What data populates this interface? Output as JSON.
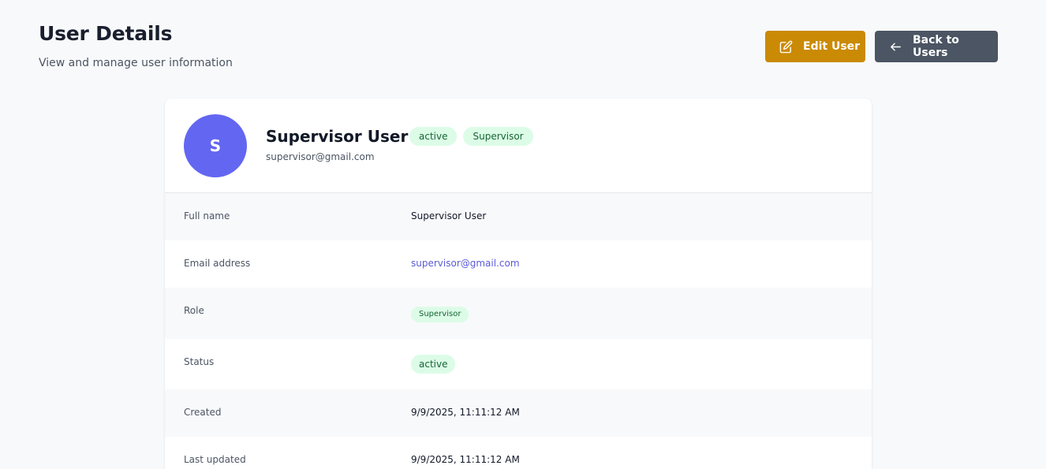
{
  "header": {
    "title": "User Details",
    "subtitle": "View and manage user information",
    "edit_label": "Edit User",
    "back_label": "Back to Users"
  },
  "icons": {
    "edit": "edit-icon",
    "back": "arrow-left-icon"
  },
  "colors": {
    "edit_button": "#ca8a04",
    "back_button": "#4b5563",
    "avatar": "#6366f1",
    "badge_bg": "#dcfce7",
    "badge_text": "#166534",
    "link": "#5b5bd6"
  },
  "profile": {
    "initial": "S",
    "name": "Supervisor User",
    "email": "supervisor@gmail.com",
    "status_badge": "active",
    "role_badge": "Supervisor"
  },
  "details": {
    "full_name": {
      "label": "Full name",
      "value": "Supervisor User"
    },
    "email": {
      "label": "Email address",
      "value": "supervisor@gmail.com"
    },
    "role": {
      "label": "Role",
      "value": "Supervisor"
    },
    "status": {
      "label": "Status",
      "value": "active"
    },
    "created": {
      "label": "Created",
      "value": "9/9/2025, 11:11:12 AM"
    },
    "updated": {
      "label": "Last updated",
      "value": "9/9/2025, 11:11:12 AM"
    }
  }
}
